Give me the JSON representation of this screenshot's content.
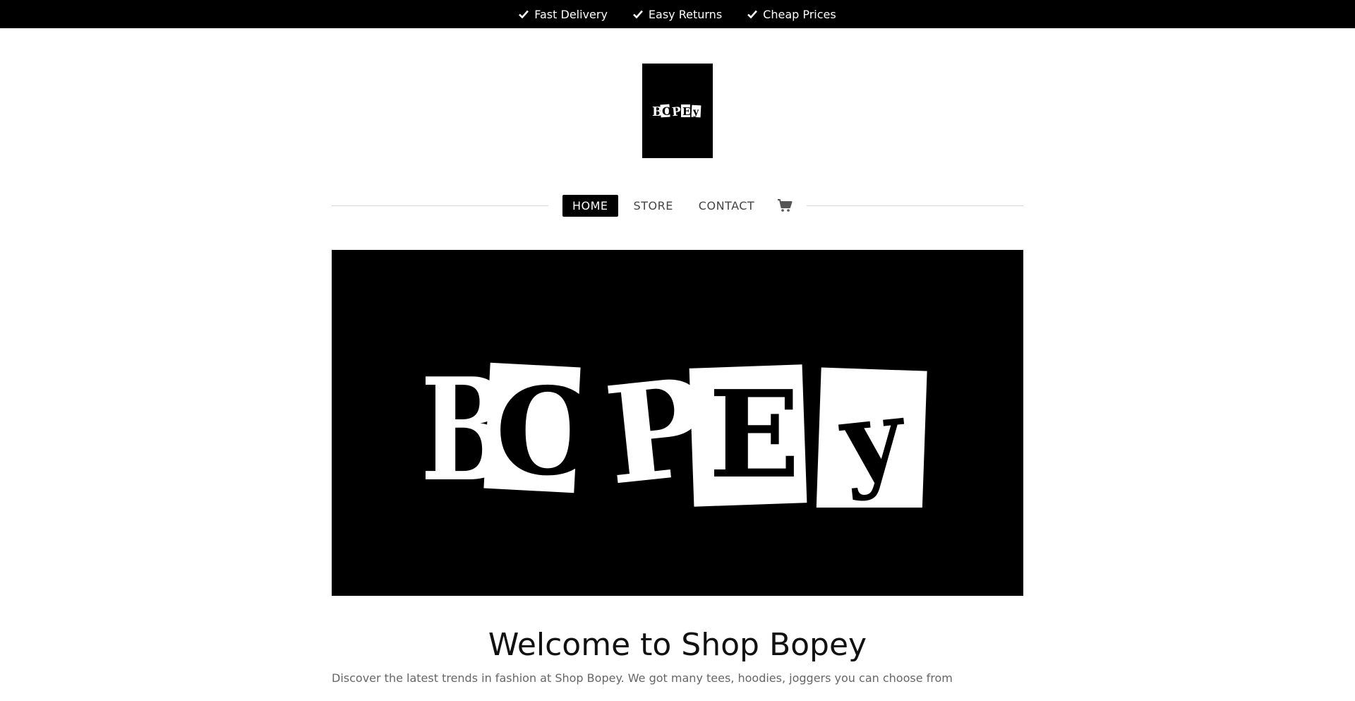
{
  "topbar": {
    "benefits": [
      {
        "icon": "check-icon",
        "label": "Fast Delivery"
      },
      {
        "icon": "check-icon",
        "label": "Easy Returns"
      },
      {
        "icon": "check-icon",
        "label": "Cheap Prices"
      }
    ]
  },
  "logo": {
    "text": "BOPEY",
    "background": "#000000",
    "foreground": "#ffffff"
  },
  "nav": {
    "items": [
      {
        "label": "HOME",
        "active": true
      },
      {
        "label": "STORE",
        "active": false
      },
      {
        "label": "CONTACT",
        "active": false
      }
    ],
    "cart_icon": "cart-icon"
  },
  "hero": {
    "text": "BOPEY"
  },
  "welcome": {
    "title": "Welcome to Shop Bopey",
    "body": "Discover the latest trends in fashion at Shop Bopey. We got many tees, hoodies, joggers you can choose from"
  }
}
